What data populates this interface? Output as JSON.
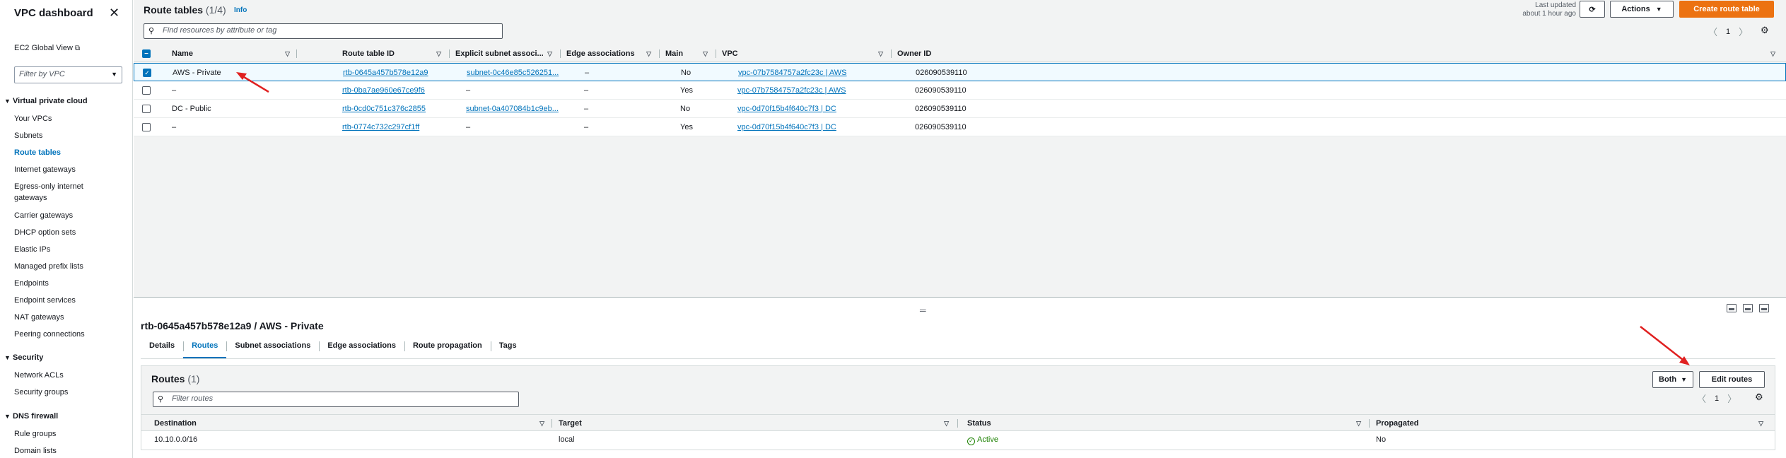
{
  "sidebar": {
    "title": "VPC dashboard",
    "ec2_global_view": "EC2 Global View",
    "filter_placeholder": "Filter by VPC",
    "sections": [
      {
        "label": "Virtual private cloud",
        "items": [
          "Your VPCs",
          "Subnets",
          "Route tables",
          "Internet gateways",
          "Egress-only internet gateways",
          "Carrier gateways",
          "DHCP option sets",
          "Elastic IPs",
          "Managed prefix lists",
          "Endpoints",
          "Endpoint services",
          "NAT gateways",
          "Peering connections"
        ]
      },
      {
        "label": "Security",
        "items": [
          "Network ACLs",
          "Security groups"
        ]
      },
      {
        "label": "DNS firewall",
        "items": [
          "Rule groups",
          "Domain lists"
        ]
      }
    ],
    "active_item": "Route tables"
  },
  "route_tables": {
    "title": "Route tables",
    "count": "(1/4)",
    "info": "Info",
    "search_placeholder": "Find resources by attribute or tag",
    "last_updated_line1": "Last updated",
    "last_updated_line2": "about 1 hour ago",
    "actions_label": "Actions",
    "create_label": "Create route table",
    "page": "1",
    "columns": [
      "Name",
      "Route table ID",
      "Explicit subnet associ...",
      "Edge associations",
      "Main",
      "VPC",
      "Owner ID"
    ],
    "rows": [
      {
        "selected": true,
        "name": "AWS - Private",
        "id": "rtb-0645a457b578e12a9",
        "subnet": "subnet-0c46e85c526251...",
        "edge": "–",
        "main": "No",
        "vpc": "vpc-07b7584757a2fc23c | AWS",
        "owner": "026090539110"
      },
      {
        "selected": false,
        "name": "–",
        "id": "rtb-0ba7ae960e67ce9f6",
        "subnet": "–",
        "edge": "–",
        "main": "Yes",
        "vpc": "vpc-07b7584757a2fc23c | AWS",
        "owner": "026090539110"
      },
      {
        "selected": false,
        "name": "DC - Public",
        "id": "rtb-0cd0c751c376c2855",
        "subnet": "subnet-0a407084b1c9eb...",
        "edge": "–",
        "main": "No",
        "vpc": "vpc-0d70f15b4f640c7f3 | DC",
        "owner": "026090539110"
      },
      {
        "selected": false,
        "name": "–",
        "id": "rtb-0774c732c297cf1ff",
        "subnet": "–",
        "edge": "–",
        "main": "Yes",
        "vpc": "vpc-0d70f15b4f640c7f3 | DC",
        "owner": "026090539110"
      }
    ]
  },
  "detail": {
    "title": "rtb-0645a457b578e12a9 / AWS - Private",
    "tabs": [
      "Details",
      "Routes",
      "Subnet associations",
      "Edge associations",
      "Route propagation",
      "Tags"
    ],
    "active_tab": "Routes",
    "routes": {
      "title": "Routes",
      "count": "(1)",
      "filter_placeholder": "Filter routes",
      "both_label": "Both",
      "edit_label": "Edit routes",
      "page": "1",
      "columns": [
        "Destination",
        "Target",
        "Status",
        "Propagated"
      ],
      "rows": [
        {
          "destination": "10.10.0.0/16",
          "target": "local",
          "status": "Active",
          "propagated": "No"
        }
      ]
    }
  },
  "colors": {
    "accent": "#0073bb",
    "primary_button": "#ec7211",
    "annotation_arrow": "#e02020",
    "status_ok": "#1d8102"
  }
}
